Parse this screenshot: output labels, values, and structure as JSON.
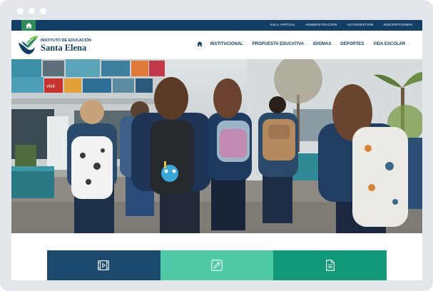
{
  "topbar": {
    "links": [
      {
        "label": "AULA VIRTUAL"
      },
      {
        "label": "ADMINISTRACION"
      },
      {
        "label": "AUTOGESTION"
      },
      {
        "label": "INSCRIPCIONES"
      }
    ]
  },
  "logo": {
    "line1": "INSTITUTO DE EDUCACIÓN",
    "line2": "Santa Elena"
  },
  "nav": {
    "items": [
      {
        "label": "INSTITUCIONAL"
      },
      {
        "label": "PROPUESTA EDUCATIVA"
      },
      {
        "label": "IDIOMAS"
      },
      {
        "label": "DEPORTES"
      },
      {
        "label": "VIDA ESCOLAR"
      }
    ]
  },
  "hero": {
    "sign_text": "vivir"
  },
  "colors": {
    "navy": "#123e64",
    "green": "#2e8b57",
    "tile_navy": "#1c4a6e",
    "tile_mint": "#4fc9a5",
    "tile_teal": "#129a78"
  },
  "icons": [
    "home-icon",
    "chevron-down-icon",
    "video-icon",
    "pencil-icon",
    "document-icon"
  ]
}
